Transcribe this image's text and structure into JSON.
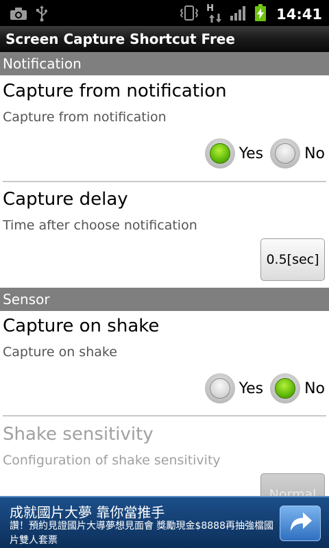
{
  "status_bar": {
    "time": "14:41",
    "network_type": "H",
    "icons_left": [
      "camera-icon",
      "usb-icon"
    ],
    "icons_right": [
      "vibrate-icon",
      "data-transfer-icon",
      "signal-icon",
      "battery-charging-icon"
    ]
  },
  "app": {
    "title": "Screen Capture Shortcut Free"
  },
  "sections": {
    "notification": {
      "label": "Notification"
    },
    "sensor": {
      "label": "Sensor"
    }
  },
  "settings": {
    "capture_from_notification": {
      "title": "Capture from notification",
      "summary": "Capture from notification",
      "options": [
        "Yes",
        "No"
      ],
      "selected": "Yes"
    },
    "capture_delay": {
      "title": "Capture delay",
      "summary": "Time after choose notification",
      "value": "0.5[sec]"
    },
    "capture_on_shake": {
      "title": "Capture on shake",
      "summary": "Capture on shake",
      "options": [
        "Yes",
        "No"
      ],
      "selected": "No"
    },
    "shake_sensitivity": {
      "title": "Shake sensitivity",
      "summary": "Configuration of shake sensitivity",
      "value": "Normal",
      "enabled": false
    }
  },
  "ad": {
    "headline": "成就國片大夢 靠你當推手",
    "body": "讚！預約見證國片大導夢想見面會 獎勵現金$8888再抽強檔國片雙人套票",
    "action_icon": "arrow-redo-icon",
    "colors": {
      "background": "#16416f",
      "button": "#4a8bd6"
    }
  },
  "colors": {
    "section_header": "#7f7f7f",
    "radio_selected": "#6cc20e"
  }
}
